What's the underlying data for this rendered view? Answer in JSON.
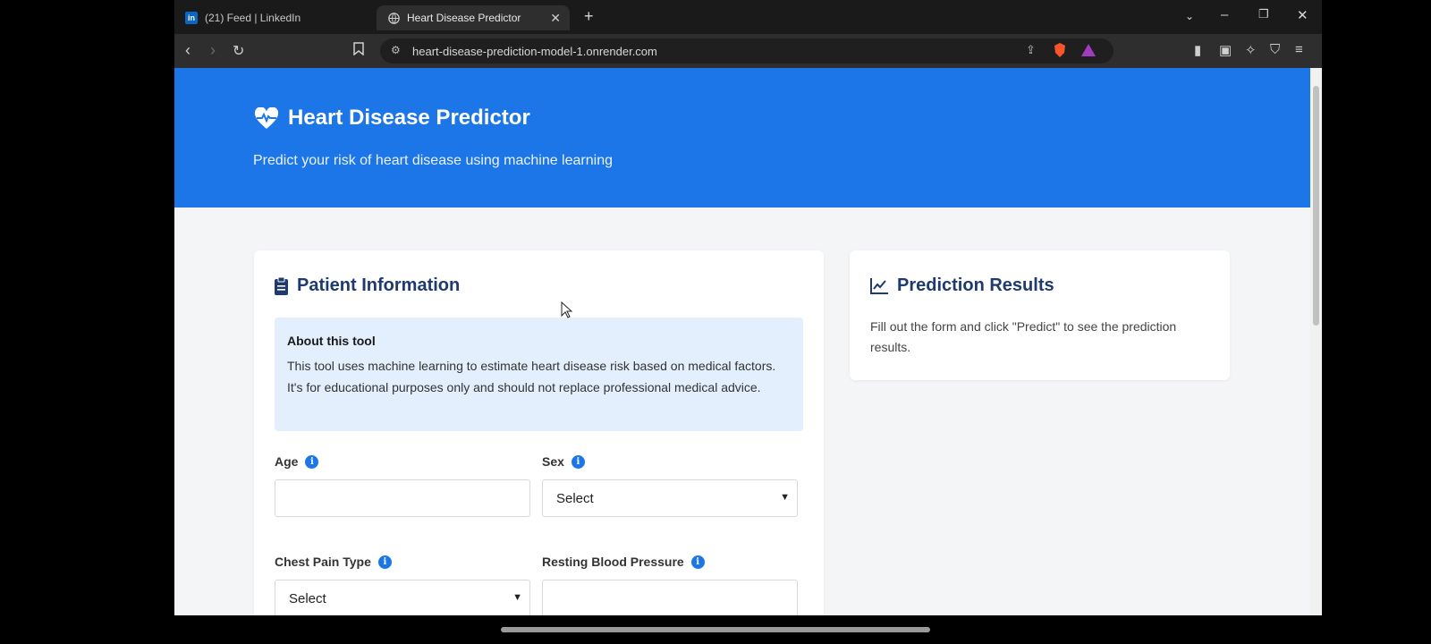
{
  "browser": {
    "tabs": [
      {
        "label": "(21) Feed | LinkedIn",
        "favicon": "linkedin-icon"
      },
      {
        "label": "Heart Disease Predictor",
        "favicon": "globe-icon",
        "active": true
      }
    ],
    "url": "heart-disease-prediction-model-1.onrender.com"
  },
  "hero": {
    "title": "Heart Disease Predictor",
    "subtitle": "Predict your risk of heart disease using machine learning",
    "icon": "heart-pulse-icon",
    "background_color": "#1c76e8"
  },
  "patient_card": {
    "title": "Patient Information",
    "icon": "clipboard-icon",
    "about": {
      "title": "About this tool",
      "text": "This tool uses machine learning to estimate heart disease risk based on medical factors. It's for educational purposes only and should not replace professional medical advice."
    },
    "fields": {
      "age": {
        "label": "Age",
        "value": ""
      },
      "sex": {
        "label": "Sex",
        "selected": "Select"
      },
      "chest_pain": {
        "label": "Chest Pain Type",
        "selected": "Select"
      },
      "resting_bp": {
        "label": "Resting Blood Pressure",
        "value": ""
      }
    }
  },
  "results_card": {
    "title": "Prediction Results",
    "icon": "chart-line-icon",
    "text": "Fill out the form and click \"Predict\" to see the prediction results."
  },
  "colors": {
    "accent": "#1c76e8",
    "title_text": "#1e3a6e",
    "about_bg": "#e3effd"
  }
}
